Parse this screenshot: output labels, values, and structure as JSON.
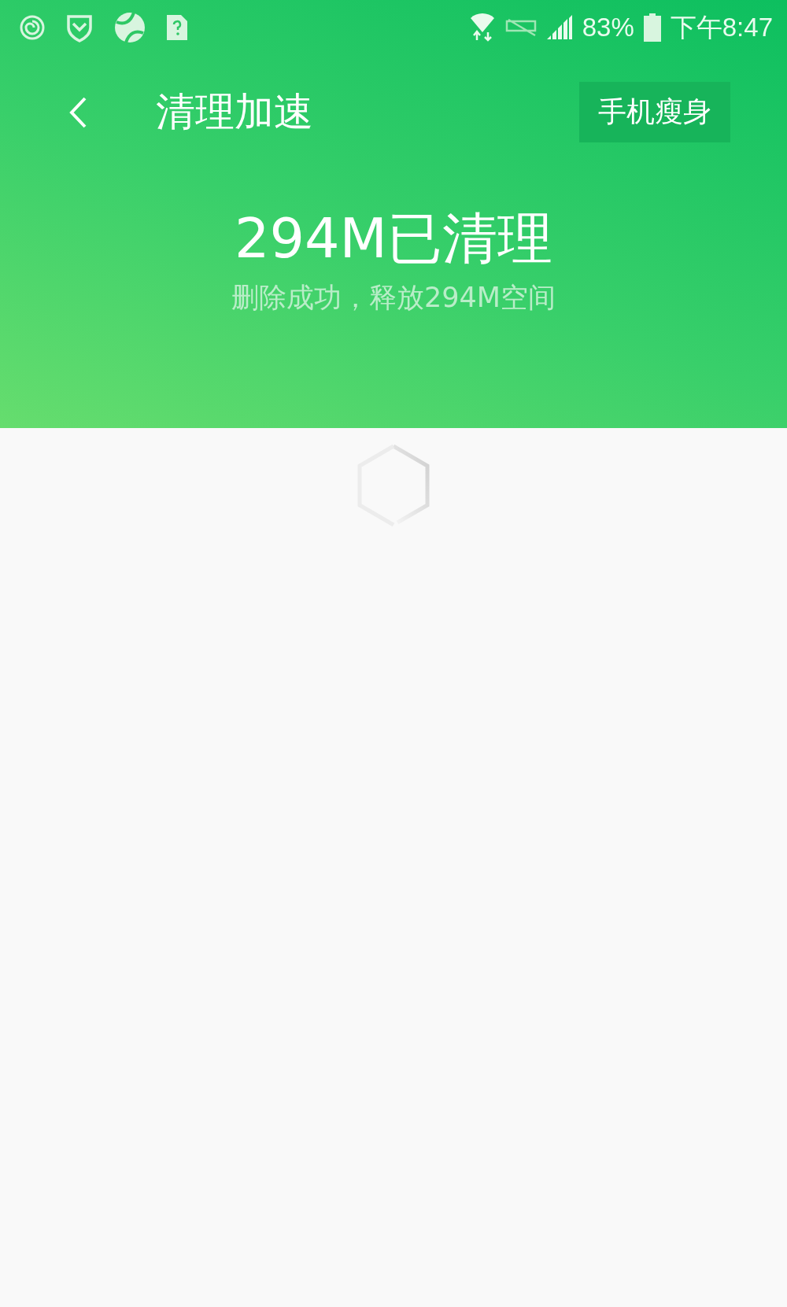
{
  "status_bar": {
    "battery": "83%",
    "time": "下午8:47"
  },
  "header": {
    "title": "清理加速",
    "action": "手机瘦身"
  },
  "result": {
    "headline": "294M已清理",
    "subtitle": "删除成功，释放294M空间"
  },
  "content": {
    "loading": true
  }
}
